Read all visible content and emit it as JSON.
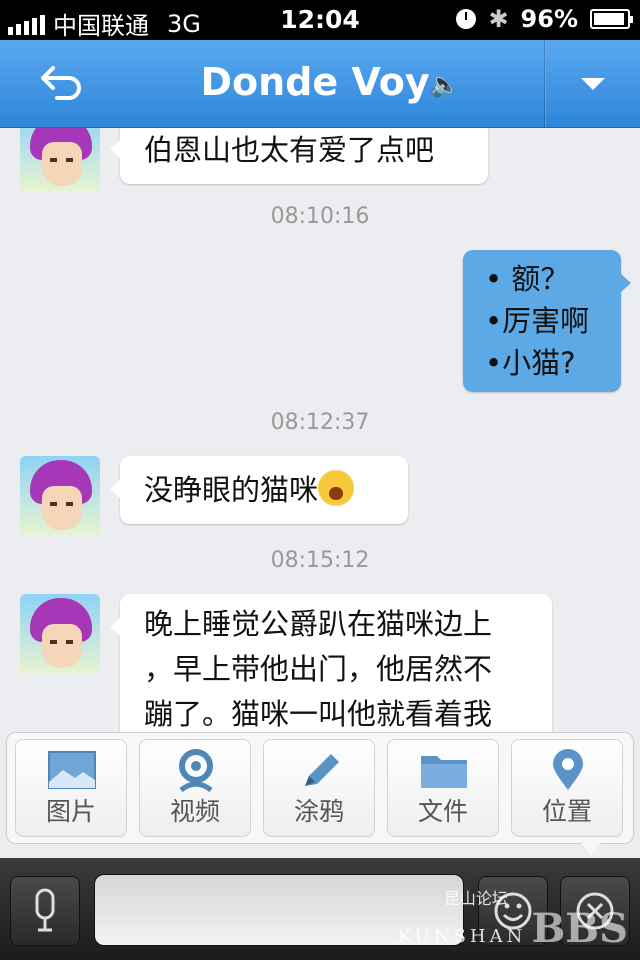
{
  "status_bar": {
    "carrier": "中国联通",
    "network": "3G",
    "time": "12:04",
    "battery": "96%"
  },
  "nav": {
    "back_icon": "back-arrow-icon",
    "title": "Donde Voy",
    "title_icon": "speaker-icon",
    "menu_icon": "dropdown-triangle-icon"
  },
  "messages": [
    {
      "type": "in",
      "text": "伯恩山也太有爱了点吧"
    },
    {
      "type": "time",
      "text": "08:10:16"
    },
    {
      "type": "out",
      "lines": [
        "•  额？",
        "•厉害啊",
        "•小猫?"
      ]
    },
    {
      "type": "time",
      "text": "08:12:37"
    },
    {
      "type": "in",
      "text": "没睁眼的猫咪",
      "emoji": "crying-face-icon"
    },
    {
      "type": "time",
      "text": "08:15:12"
    },
    {
      "type": "in",
      "lines": [
        "晚上睡觉公爵趴在猫咪边上",
        "，早上带他出门，他居然不",
        "蹦了。猫咪一叫他就看着我"
      ]
    }
  ],
  "tools": [
    {
      "label": "图片",
      "icon": "image-icon"
    },
    {
      "label": "视频",
      "icon": "video-camera-icon"
    },
    {
      "label": "涂鸦",
      "icon": "pencil-icon"
    },
    {
      "label": "文件",
      "icon": "folder-icon"
    },
    {
      "label": "位置",
      "icon": "location-pin-icon"
    }
  ],
  "input_bar": {
    "text_value": "",
    "voice_icon": "microphone-icon",
    "emoji_icon": "smiley-icon",
    "close_icon": "close-circle-icon"
  },
  "watermark": {
    "cn": "昆山论坛",
    "en": "KUNSHAN",
    "bbs": "BBS"
  },
  "colors": {
    "nav_blue": "#2e86da",
    "outgoing_bubble": "#5ca9e6",
    "background": "#ecedf0"
  }
}
